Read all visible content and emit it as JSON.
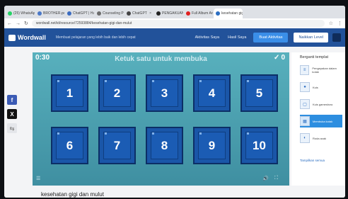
{
  "browser": {
    "tabs": [
      {
        "label": "(25) WhatsApp",
        "color": "#25d366"
      },
      {
        "label": "BROTHER.pdf",
        "color": "#4a78c8"
      },
      {
        "label": "ChatGPT | Ha…",
        "color": "#3a6bc0"
      },
      {
        "label": "Counseling P…",
        "color": "#6c6c6c"
      },
      {
        "label": "ChatGPT",
        "color": "#444444"
      },
      {
        "label": "PENGAKUAN P…",
        "color": "#222222"
      },
      {
        "label": "Full Album Ari…",
        "color": "#e02020"
      },
      {
        "label": "kesehatan gigi…",
        "color": "#2d6fc2"
      }
    ],
    "active_tab": 7,
    "url": "wordwall.net/id/resource/72593884/kesehatan-gigi-dan-mulut"
  },
  "header": {
    "logo": "Wordwall",
    "tagline": "Membuat pelajaran yang lebih baik dan lebih cepat",
    "links": [
      "Aktivitas Saya",
      "Hasil Saya"
    ],
    "create_button": "Buat Aktivitas",
    "login_button": "Naikkan Level"
  },
  "share": {
    "facebook": "f",
    "x": "X",
    "other": "⇆"
  },
  "game": {
    "timer": "0:30",
    "instruction": "Ketuk satu untuk membuka",
    "score": "0",
    "tiles": [
      "1",
      "2",
      "3",
      "4",
      "5",
      "6",
      "7",
      "8",
      "9",
      "10"
    ],
    "colors": {
      "tile": "#1a56a8",
      "bg": "#4a9aaa"
    }
  },
  "side": {
    "title": "Berganti templat",
    "options": [
      {
        "label": "Pengepakan dalam kotak",
        "icon": "≡"
      },
      {
        "label": "Kuis",
        "icon": "●"
      },
      {
        "label": "Kuis gameshow",
        "icon": "▢"
      },
      {
        "label": "Membuka kotak",
        "icon": "▦"
      },
      {
        "label": "Roda acak",
        "icon": "◐"
      }
    ],
    "active_option": 3,
    "more": "Tampilkan semua"
  },
  "activity": {
    "title": "kesehatan gigi dan mulut"
  }
}
